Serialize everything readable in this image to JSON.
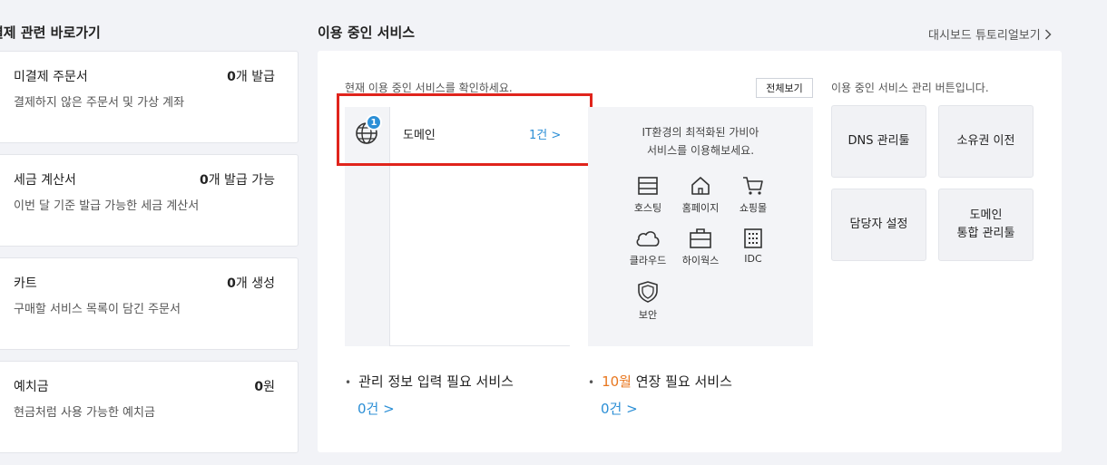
{
  "left": {
    "title": "결제 관련 바로가기",
    "cards": [
      {
        "name": "미결제 주문서",
        "desc": "결제하지 않은 주문서 및 가상 계좌",
        "count": "0",
        "unit": "개 발급"
      },
      {
        "name": "세금 계산서",
        "desc": "이번 달 기준 발급 가능한 세금 계산서",
        "count": "0",
        "unit": "개 발급 가능"
      },
      {
        "name": "카트",
        "desc": "구매할 서비스 목록이 담긴 주문서",
        "count": "0",
        "unit": "개 생성"
      },
      {
        "name": "예치금",
        "desc": "현금처럼 사용 가능한 예치금",
        "count": "0",
        "unit": "원"
      }
    ]
  },
  "services": {
    "title": "이용 중인 서비스",
    "tutorial": "대시보드 튜토리얼보기",
    "intro": "현재 이용 중인 서비스를 확인하세요.",
    "view_all": "전체보기",
    "domain": {
      "label": "도메인",
      "count": "1건 >",
      "badge": "1",
      "icon": "globe-icon"
    },
    "promo": {
      "line1": "IT환경의 최적화된 가비아",
      "line2": "서비스를 이용해보세요.",
      "items": [
        {
          "label": "호스팅",
          "icon": "server-icon"
        },
        {
          "label": "홈페이지",
          "icon": "house-icon"
        },
        {
          "label": "쇼핑몰",
          "icon": "cart-icon"
        },
        {
          "label": "클라우드",
          "icon": "cloud-icon"
        },
        {
          "label": "하이웍스",
          "icon": "briefcase-icon"
        },
        {
          "label": "IDC",
          "icon": "building-icon"
        },
        {
          "label": "보안",
          "icon": "shield-icon"
        }
      ]
    },
    "manage_desc": "이용 중인 서비스 관리 버튼입니다.",
    "manage_buttons": [
      {
        "line1": "DNS 관리툴",
        "line2": ""
      },
      {
        "line1": "소유권 이전",
        "line2": ""
      },
      {
        "line1": "담당자 설정",
        "line2": ""
      },
      {
        "line1": "도메인",
        "line2": "통합 관리툴"
      }
    ],
    "info_required": {
      "label": "관리 정보 입력 필요 서비스",
      "count": "0건 >"
    },
    "renewal": {
      "month": "10월",
      "label": " 연장 필요 서비스",
      "count": "0건 >"
    }
  },
  "colors": {
    "accent": "#2c8fd6",
    "highlight": "#e0241c",
    "month": "#e8771f"
  }
}
